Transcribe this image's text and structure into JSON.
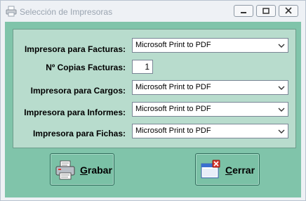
{
  "window": {
    "title": "Selección de Impresoras"
  },
  "fields": {
    "facturas": {
      "label": "Impresora para Facturas:",
      "value": "Microsoft Print to PDF"
    },
    "copias": {
      "label": "Nº Copias Facturas:",
      "value": "1"
    },
    "cargos": {
      "label": "Impresora para Cargos:",
      "value": "Microsoft Print to PDF"
    },
    "informes": {
      "label": "Impresora para Informes:",
      "value": "Microsoft Print to PDF"
    },
    "fichas": {
      "label": "Impresora para Fichas:",
      "value": "Microsoft Print to PDF"
    }
  },
  "buttons": {
    "grabar": {
      "accel": "G",
      "rest": "rabar",
      "icon": "printer-icon"
    },
    "cerrar": {
      "accel": "C",
      "rest": "errar",
      "icon": "close-window-icon"
    }
  },
  "colors": {
    "panel": "#80c4aa",
    "frame": "#b8dccd",
    "button": "#7bc1a6"
  }
}
